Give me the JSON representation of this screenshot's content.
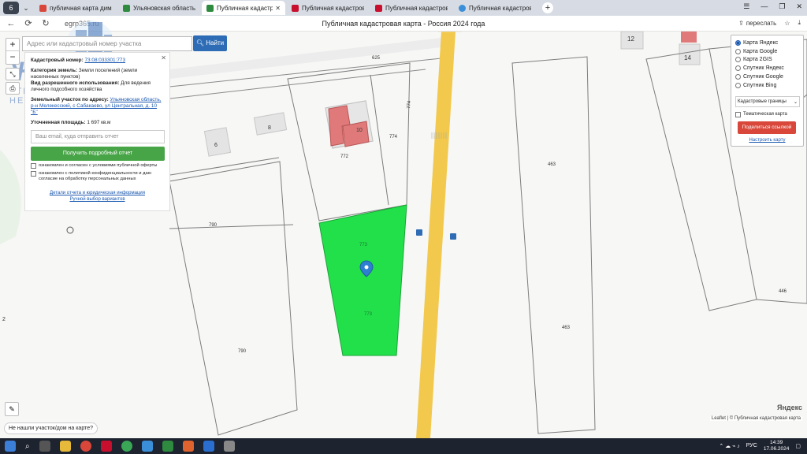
{
  "browser": {
    "tabs": [
      {
        "label": "публичная карта димитровград",
        "fav_color": "#d9473a",
        "active": false
      },
      {
        "label": "Ульяновская область, р-н",
        "fav_color": "#2d8a3e",
        "active": false
      },
      {
        "label": "Публичная кадастровая",
        "fav_color": "#2d8a3e",
        "active": true
      },
      {
        "label": "Публичная кадастровая к",
        "fav_color": "#c8102e",
        "active": false
      },
      {
        "label": "Публичная кадастровая к",
        "fav_color": "#c8102e",
        "active": false
      },
      {
        "label": "Публичная кадастровая",
        "fav_color": "#3a8fd8",
        "active": false
      }
    ],
    "tab_count": "6",
    "url": "egrp365.ru",
    "page_title": "Публичная кадастровая карта - Россия 2024 года",
    "share_label": "переслать"
  },
  "search": {
    "placeholder": "Адрес или кадастровый номер участка",
    "find_label": "Найти"
  },
  "info_panel": {
    "cad_label": "Кадастровый номер:",
    "cad_value": "73:08:033301:773",
    "category_label": "Категория земель:",
    "category_value": "Земли поселений (земли населенных пунктов)",
    "use_label": "Вид разрешенного использования:",
    "use_value": "Для ведения личного подсобного хозяйства",
    "address_label": "Земельный участок по адресу:",
    "address_value": "Ульяновская область, р-н Мелекесский, с Сабакаево, ул Центральная, д. 10 \"Б\"",
    "area_label": "Уточненная площадь:",
    "area_value": "1 697 кв.м",
    "email_placeholder": "Ваш email, куда отправить отчет",
    "get_report": "Получить подробный отчет",
    "consent1": "ознакомлен и согласен с условиями публичной оферты",
    "consent2": "ознакомлен с политикой конфиденциальности и даю согласие на обработку персональных данных",
    "details_link": "Детали отчета и юридическая информация",
    "manual_link": "Ручной выбор вариантов"
  },
  "watermark": {
    "title": "Жемчужина",
    "subtitle": "АГЕНТСТВО НЕДВИЖИМОСТИ"
  },
  "layers": {
    "options": [
      {
        "label": "Карта Яндекс",
        "selected": true
      },
      {
        "label": "Карта Google",
        "selected": false
      },
      {
        "label": "Карта 2GIS",
        "selected": false
      },
      {
        "label": "Спутник Яндекс",
        "selected": false
      },
      {
        "label": "Спутник Google",
        "selected": false
      },
      {
        "label": "Спутник Bing",
        "selected": false
      }
    ],
    "boundaries_select": "Кадастровые границы",
    "thematic_label": "Тематическая карта",
    "share_button": "Поделиться ссылкой",
    "setup_link": "Настроить карту"
  },
  "map": {
    "parcel_labels": [
      "625",
      "12",
      "14",
      "774",
      "774",
      "10",
      "772",
      "8",
      "6",
      "463",
      "790",
      "773",
      "773",
      "463",
      "446",
      "790",
      "2"
    ],
    "accent_green": "#22e04a",
    "road_color": "#f2c94c",
    "house_color": "#e07a7a"
  },
  "bottom": {
    "not_found": "Не нашли участок/дом на карте?",
    "attribution": "Leaflet | © Публичная кадастровая карта",
    "yandex": "Яндекс",
    "pencil_icon": "pencil-icon"
  },
  "taskbar": {
    "lang": "РУС",
    "time": "14:39",
    "date": "17.06.2024"
  }
}
